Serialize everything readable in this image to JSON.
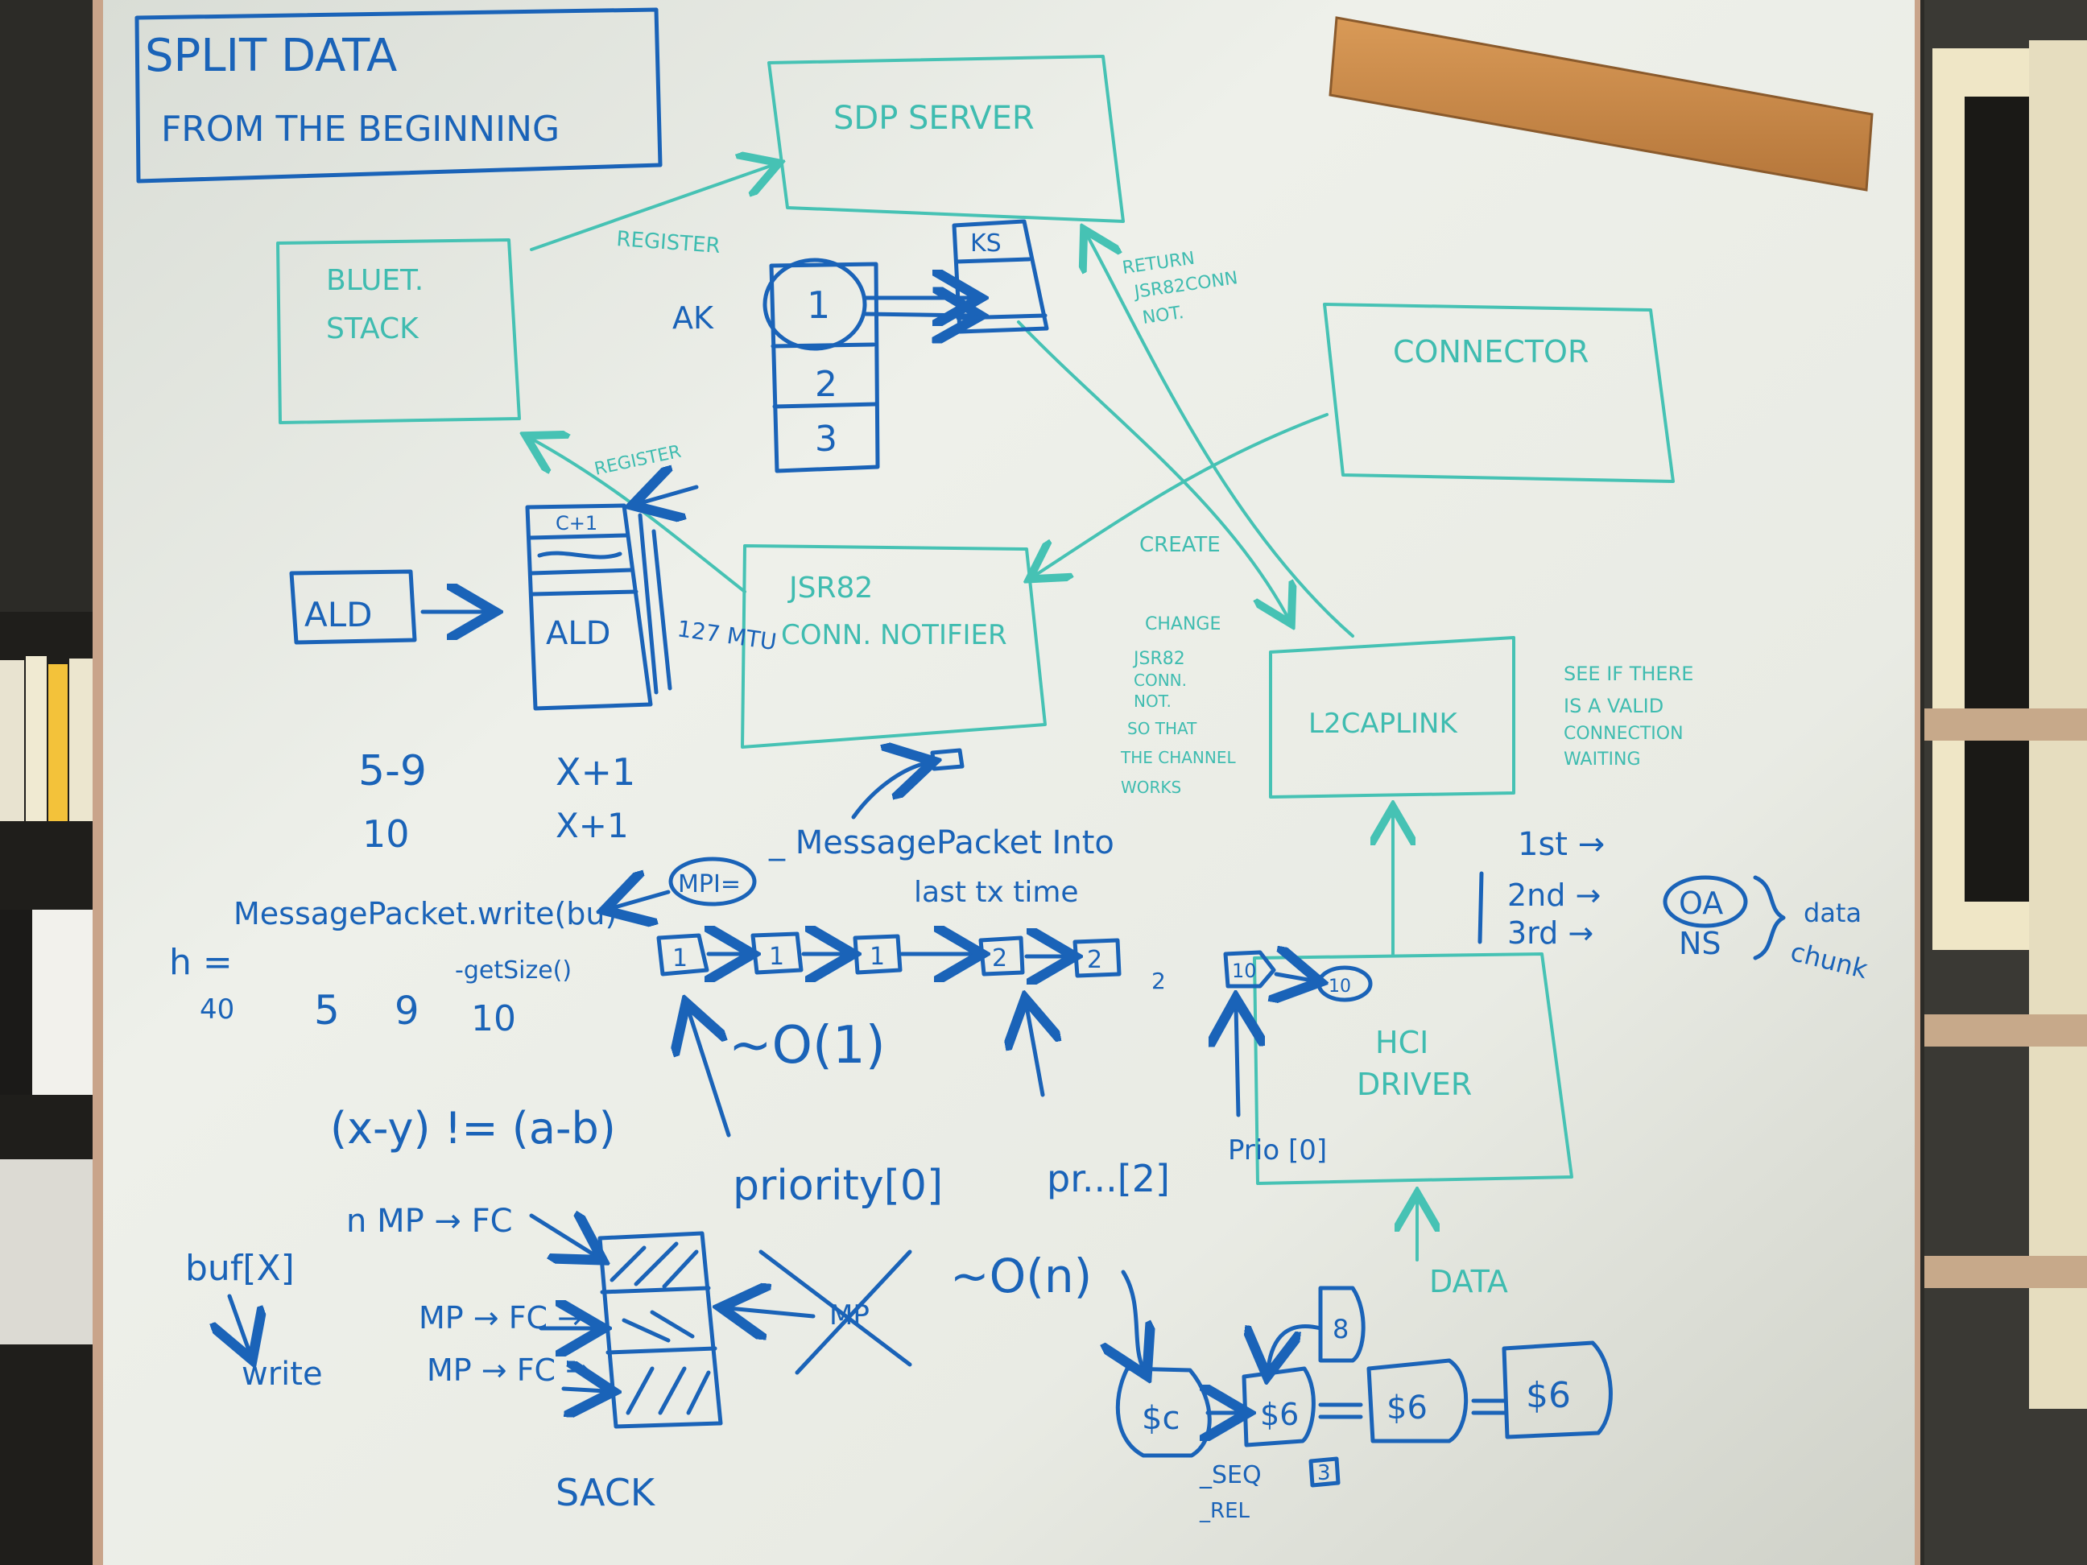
{
  "title_box": {
    "line1": "SPLIT DATA",
    "line2": "FROM THE BEGINNING"
  },
  "boxes": {
    "sdp_server": "SDP SERVER",
    "bluet_stack_1": "BLUET.",
    "bluet_stack_2": "STACK",
    "connector": "CONNECTOR",
    "jsr82_1": "JSR82",
    "jsr82_2": "CONN. NOTIFIER",
    "l2cap": "L2CAPLINK",
    "hci_1": "HCI",
    "hci_2": "DRIVER"
  },
  "teal_notes": {
    "register_top": "REGISTER",
    "register_left": "REGISTER",
    "return_1": "RETURN",
    "return_2": "JSR82CONN",
    "return_3": "NOT.",
    "create": "CREATE",
    "change_1": "CHANGE",
    "change_2": "JSR82",
    "change_3": "CONN.",
    "change_4": "NOT.",
    "change_5": "SO THAT",
    "change_6": "THE CHANNEL",
    "change_7": "WORKS",
    "see_1": "SEE IF THERE",
    "see_2": "IS A VALID",
    "see_3": "CONNECTION",
    "see_4": "WAITING",
    "data": "DATA"
  },
  "blue_notes": {
    "ks": "KS",
    "ak": "AK",
    "stack_1": "1",
    "stack_2": "2",
    "stack_3": "3",
    "c1": "C+1",
    "ald_left": "ALD",
    "ald_inside": "ALD",
    "mtu": "127 MTU",
    "n59": "5-9",
    "x1a": "X+1",
    "n10": "10",
    "x1b": "X+1",
    "mpi_into": "_ MessagePacket Into",
    "last_tx": "last tx time",
    "mpi": "MPI=",
    "write_call": "MessagePacket.write(bu)",
    "getsize": "-getSize()",
    "h_eq": "h =",
    "n40": "40",
    "n5": "5",
    "n9": "9",
    "n10b": "10",
    "o1": "~O(1)",
    "xy": "(x-y) != (a-b)",
    "priority": "priority[0]",
    "pr": "pr...[2]",
    "prio": "Prio [0]",
    "first": "1st →",
    "second": "2nd →",
    "third": "3rd →",
    "oa": "OA",
    "ns": "NS",
    "data_chunk_1": "data",
    "data_chunk_2": "chunk",
    "mp_fc_1": "n MP → FC",
    "mp_fc_2": "MP → FC →",
    "mp_fc_3": "MP → FC →",
    "buf": "buf[X]",
    "write": "write",
    "on": "~O(n)",
    "sack": "SACK",
    "mp_crossed": "MP",
    "seq": "_SEQ",
    "seq_box": "3",
    "rel": "_REL",
    "chain_1": "1",
    "chain_2": "1",
    "chain_3": "1",
    "chain_4": "2",
    "chain_5": "2",
    "chain_6": "2",
    "chain_7": "10",
    "chain_8": "10",
    "dollar_1": "$c",
    "dollar_2": "$6",
    "dollar_3": "$6",
    "dollar_4": "$6",
    "dollar_top": "8"
  },
  "colors": {
    "board": "#f1f3ee",
    "marker_blue": "#1a63b8",
    "marker_teal": "#46c2b4",
    "frame": "#c9a48a",
    "cork": "#c98a4a"
  }
}
